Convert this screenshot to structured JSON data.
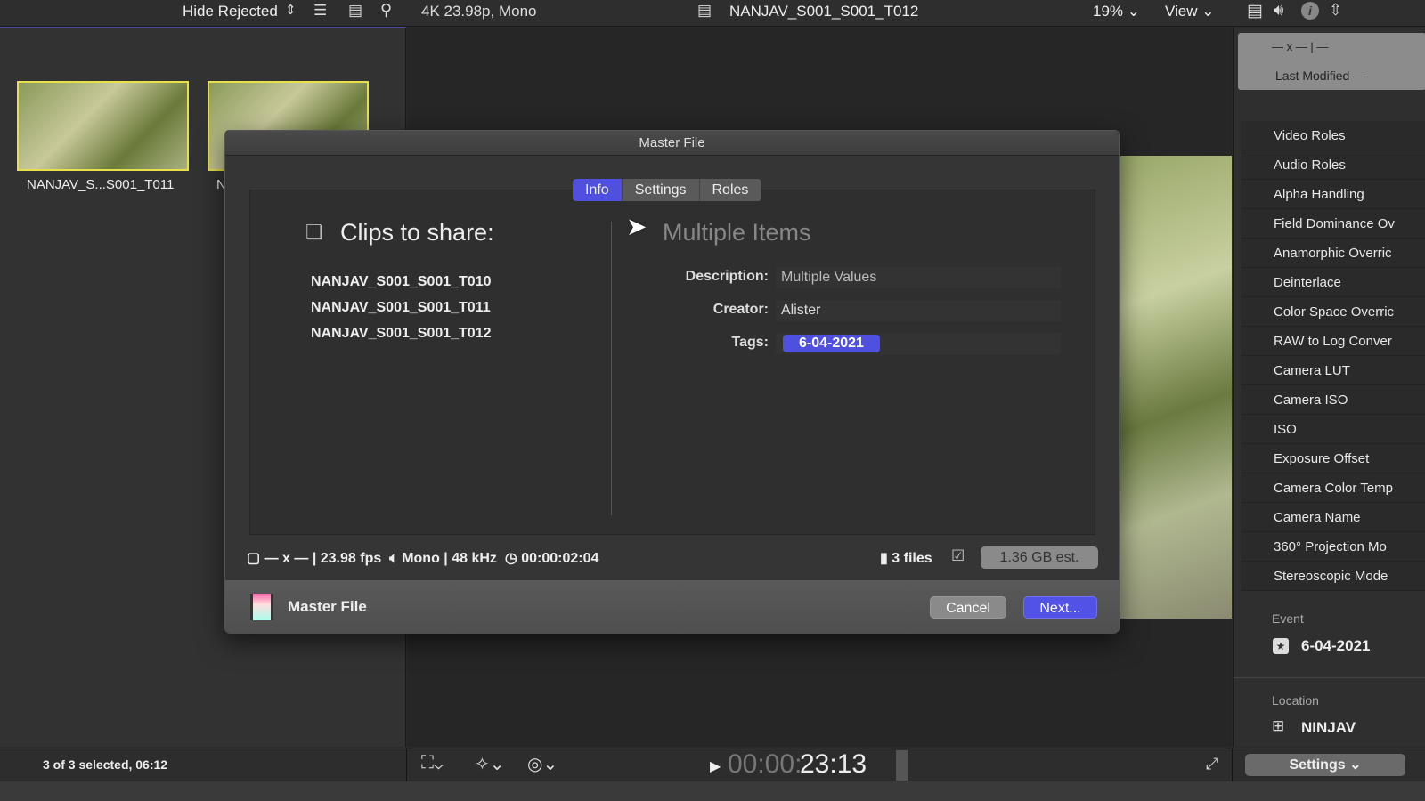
{
  "topbar": {
    "filter": "Hide Rejected",
    "format": "4K 23.98p, Mono",
    "clip_name": "NANJAV_S001_S001_T012",
    "zoom": "19%",
    "view": "View"
  },
  "browser": {
    "clips": [
      {
        "label": "NANJAV_S...S001_T011"
      },
      {
        "label": "N"
      }
    ],
    "status": "3 of 3 selected, 06:12"
  },
  "inspector": {
    "header_dims": "— x — | —",
    "last_modified": "Last Modified —",
    "items": [
      "Video Roles",
      "Audio Roles",
      "Alpha Handling",
      "Field Dominance Ov",
      "Anamorphic Overric",
      "Deinterlace",
      "Color Space Overric",
      "RAW to Log Conver",
      "Camera LUT",
      "Camera ISO",
      "ISO",
      "Exposure Offset",
      "Camera Color Temp",
      "Camera Name",
      "360° Projection Mo",
      "Stereoscopic Mode"
    ],
    "event_label": "Event",
    "event_value": "6-04-2021",
    "location_label": "Location",
    "location_value": "NINJAV",
    "settings": "Settings"
  },
  "dialog": {
    "title": "Master File",
    "tabs": [
      "Info",
      "Settings",
      "Roles"
    ],
    "active_tab": "Info",
    "clips_heading": "Clips to share:",
    "clips": [
      "NANJAV_S001_S001_T010",
      "NANJAV_S001_S001_T011",
      "NANJAV_S001_S001_T012"
    ],
    "items_heading": "Multiple Items",
    "description_label": "Description:",
    "description_value": "Multiple Values",
    "creator_label": "Creator:",
    "creator_value": "Alister",
    "tags_label": "Tags:",
    "tag": "6-04-2021",
    "stats": {
      "dims": "— x —",
      "fps": "23.98 fps",
      "audio": "Mono",
      "rate": "48 kHz",
      "duration": "00:00:02:04",
      "files": "3 files",
      "size": "1.36 GB est."
    },
    "footer_label": "Master File",
    "cancel": "Cancel",
    "next": "Next..."
  },
  "timecode": {
    "dim": "00:00:",
    "bright": "23:13"
  },
  "colors": {
    "accent": "#4f4fe0",
    "selection": "#e8e04a"
  }
}
